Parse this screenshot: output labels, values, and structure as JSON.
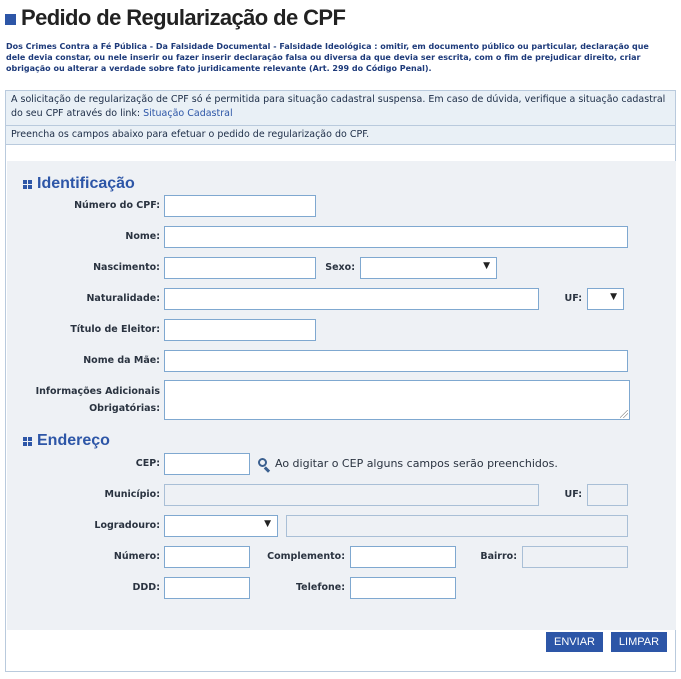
{
  "page": {
    "title": "Pedido de Regularização de CPF",
    "legal_text": "Dos Crimes Contra a Fé Pública - Da Falsidade Documental - Falsidade Ideológica : omitir, em documento público ou particular, declaração que dele devia constar, ou nele inserir ou fazer inserir declaração falsa ou diversa da que devia ser escrita, com o fim de prejudicar direito, criar obrigação ou alterar a verdade sobre fato juridicamente relevante (Art. 299 do Código Penal).",
    "info_text": "A solicitação de regularização de CPF só é permitida para situação cadastral suspensa. Em caso de dúvida, verifique a situação cadastral do seu CPF através do link: ",
    "info_link": "Situação Cadastral",
    "hint_text": "Preencha os campos abaixo para efetuar o pedido de regularização do CPF."
  },
  "identificacao": {
    "title": "Identificação",
    "cpf_label": "Número do CPF:",
    "nome_label": "Nome:",
    "nascimento_label": "Nascimento:",
    "sexo_label": "Sexo:",
    "naturalidade_label": "Naturalidade:",
    "uf_label": "UF:",
    "titulo_label": "Título de Eleitor:",
    "mae_label": "Nome da Mãe:",
    "info_adic_label_1": "Informações Adicionais",
    "info_adic_label_2": "Obrigatórias:"
  },
  "endereco": {
    "title": "Endereço",
    "cep_label": "CEP:",
    "cep_hint": "Ao digitar o CEP alguns campos serão preenchidos.",
    "municipio_label": "Município:",
    "uf_label": "UF:",
    "logradouro_label": "Logradouro:",
    "numero_label": "Número:",
    "complemento_label": "Complemento:",
    "bairro_label": "Bairro:",
    "ddd_label": "DDD:",
    "telefone_label": "Telefone:"
  },
  "buttons": {
    "enviar": "ENVIAR",
    "limpar": "LIMPAR"
  },
  "icons": {
    "title_marker": "square-bullet-icon",
    "section_marker": "grid-icon",
    "cep_search": "search-icon",
    "dropdown": "chevron-down-icon"
  },
  "colors": {
    "accent": "#2d56a7",
    "info_background": "#e9f0f6",
    "form_background": "#eef1f5",
    "input_border": "#7fa8d0"
  }
}
